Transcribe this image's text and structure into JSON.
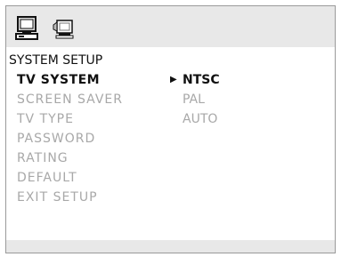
{
  "toolbar": {
    "icons": [
      "computer-setup-icon",
      "monitor-preferences-icon"
    ]
  },
  "section": {
    "title": "SYSTEM SETUP"
  },
  "menu": {
    "items": [
      {
        "label": "TV SYSTEM"
      },
      {
        "label": "SCREEN SAVER"
      },
      {
        "label": "TV TYPE"
      },
      {
        "label": "PASSWORD"
      },
      {
        "label": "RATING"
      },
      {
        "label": "DEFAULT"
      },
      {
        "label": "EXIT SETUP"
      }
    ]
  },
  "options": {
    "pointer": "▶",
    "items": [
      {
        "label": "NTSC"
      },
      {
        "label": "PAL"
      },
      {
        "label": "AUTO"
      }
    ]
  },
  "colors": {
    "active": "#111111",
    "inactive": "#a8a8a8",
    "bar": "#e8e8e8"
  }
}
